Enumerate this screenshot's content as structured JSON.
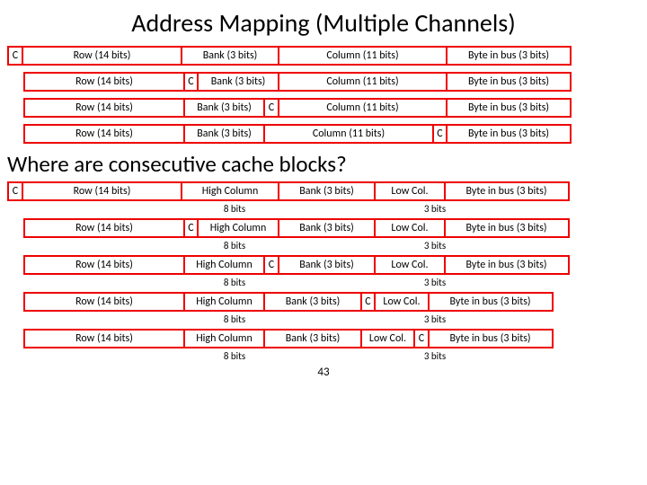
{
  "title": "Address Mapping (Multiple Channels)",
  "subtitle": "Where are consecutive cache blocks?",
  "labels": {
    "c": "C",
    "row": "Row (14 bits)",
    "bank": "Bank (3 bits)",
    "column": "Column (11 bits)",
    "byte": "Byte in bus (3 bits)",
    "hicol": "High Column",
    "lowcol": "Low Col.",
    "bits8": "8 bits",
    "bits3": "3 bits"
  },
  "page": "43"
}
